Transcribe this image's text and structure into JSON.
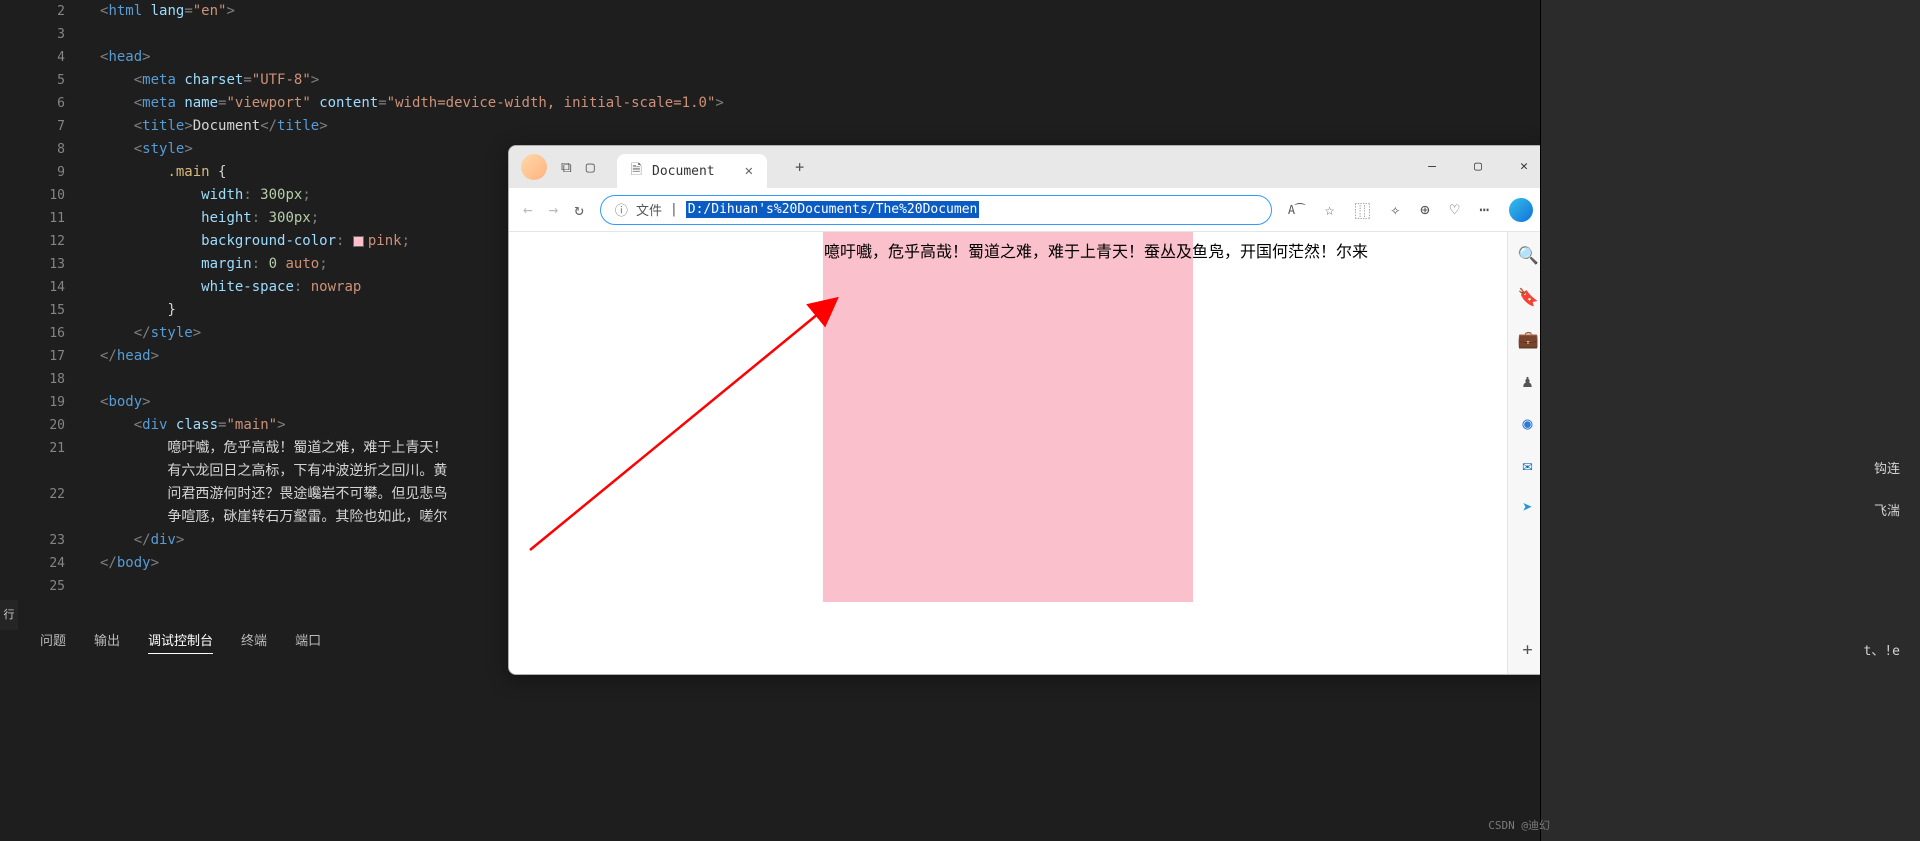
{
  "editor": {
    "line_start": 2,
    "lines": [
      [
        {
          "t": "p",
          "v": "<"
        },
        {
          "t": "tag",
          "v": "html"
        },
        {
          "t": "p",
          "v": " "
        },
        {
          "t": "attr",
          "v": "lang"
        },
        {
          "t": "p",
          "v": "="
        },
        {
          "t": "str",
          "v": "\"en\""
        },
        {
          "t": "p",
          "v": ">"
        }
      ],
      [],
      [
        {
          "t": "p",
          "v": "<"
        },
        {
          "t": "tag",
          "v": "head"
        },
        {
          "t": "p",
          "v": ">"
        }
      ],
      [
        {
          "t": "p",
          "v": "    <"
        },
        {
          "t": "tag",
          "v": "meta"
        },
        {
          "t": "p",
          "v": " "
        },
        {
          "t": "attr",
          "v": "charset"
        },
        {
          "t": "p",
          "v": "="
        },
        {
          "t": "str",
          "v": "\"UTF-8\""
        },
        {
          "t": "p",
          "v": ">"
        }
      ],
      [
        {
          "t": "p",
          "v": "    <"
        },
        {
          "t": "tag",
          "v": "meta"
        },
        {
          "t": "p",
          "v": " "
        },
        {
          "t": "attr",
          "v": "name"
        },
        {
          "t": "p",
          "v": "="
        },
        {
          "t": "str",
          "v": "\"viewport\""
        },
        {
          "t": "p",
          "v": " "
        },
        {
          "t": "attr",
          "v": "content"
        },
        {
          "t": "p",
          "v": "="
        },
        {
          "t": "str",
          "v": "\"width=device-width, initial-scale=1.0\""
        },
        {
          "t": "p",
          "v": ">"
        }
      ],
      [
        {
          "t": "p",
          "v": "    <"
        },
        {
          "t": "tag",
          "v": "title"
        },
        {
          "t": "p",
          "v": ">"
        },
        {
          "t": "cn",
          "v": "Document"
        },
        {
          "t": "p",
          "v": "</"
        },
        {
          "t": "tag",
          "v": "title"
        },
        {
          "t": "p",
          "v": ">"
        }
      ],
      [
        {
          "t": "p",
          "v": "    <"
        },
        {
          "t": "tag",
          "v": "style"
        },
        {
          "t": "p",
          "v": ">"
        }
      ],
      [
        {
          "t": "p",
          "v": "        "
        },
        {
          "t": "sel",
          "v": ".main"
        },
        {
          "t": "p",
          "v": " "
        },
        {
          "t": "brace",
          "v": "{"
        }
      ],
      [
        {
          "t": "p",
          "v": "            "
        },
        {
          "t": "prop",
          "v": "width"
        },
        {
          "t": "p",
          "v": ": "
        },
        {
          "t": "num",
          "v": "300px"
        },
        {
          "t": "p",
          "v": ";"
        }
      ],
      [
        {
          "t": "p",
          "v": "            "
        },
        {
          "t": "prop",
          "v": "height"
        },
        {
          "t": "p",
          "v": ": "
        },
        {
          "t": "num",
          "v": "300px"
        },
        {
          "t": "p",
          "v": ";"
        }
      ],
      [
        {
          "t": "p",
          "v": "            "
        },
        {
          "t": "prop",
          "v": "background-color"
        },
        {
          "t": "p",
          "v": ": "
        },
        {
          "t": "swatch",
          "v": ""
        },
        {
          "t": "kw",
          "v": "pink"
        },
        {
          "t": "p",
          "v": ";"
        }
      ],
      [
        {
          "t": "p",
          "v": "            "
        },
        {
          "t": "prop",
          "v": "margin"
        },
        {
          "t": "p",
          "v": ": "
        },
        {
          "t": "num",
          "v": "0"
        },
        {
          "t": "p",
          "v": " "
        },
        {
          "t": "kw",
          "v": "auto"
        },
        {
          "t": "p",
          "v": ";"
        }
      ],
      [
        {
          "t": "p",
          "v": "            "
        },
        {
          "t": "prop",
          "v": "white-space"
        },
        {
          "t": "p",
          "v": ": "
        },
        {
          "t": "kw",
          "v": "nowrap"
        }
      ],
      [
        {
          "t": "p",
          "v": "        "
        },
        {
          "t": "brace",
          "v": "}"
        }
      ],
      [
        {
          "t": "p",
          "v": "    </"
        },
        {
          "t": "tag",
          "v": "style"
        },
        {
          "t": "p",
          "v": ">"
        }
      ],
      [
        {
          "t": "p",
          "v": "</"
        },
        {
          "t": "tag",
          "v": "head"
        },
        {
          "t": "p",
          "v": ">"
        }
      ],
      [],
      [
        {
          "t": "p",
          "v": "<"
        },
        {
          "t": "tag",
          "v": "body"
        },
        {
          "t": "p",
          "v": ">"
        }
      ],
      [
        {
          "t": "p",
          "v": "    <"
        },
        {
          "t": "tag",
          "v": "div"
        },
        {
          "t": "p",
          "v": " "
        },
        {
          "t": "attr",
          "v": "class"
        },
        {
          "t": "p",
          "v": "="
        },
        {
          "t": "str",
          "v": "\"main\""
        },
        {
          "t": "p",
          "v": ">"
        }
      ],
      [
        {
          "t": "cn",
          "v": "        噫吁嚱，危乎高哉！蜀道之难，难于上青天！"
        }
      ],
      [
        {
          "t": "cn",
          "v": "        有六龙回日之高标，下有冲波逆折之回川。黄"
        }
      ],
      [
        {
          "t": "cn",
          "v": "        问君西游何时还？畏途巉岩不可攀。但见悲鸟"
        }
      ],
      [
        {
          "t": "cn",
          "v": "        争喧豗，砯崖转石万壑雷。其险也如此，嗟尔"
        }
      ],
      [
        {
          "t": "p",
          "v": "    </"
        },
        {
          "t": "tag",
          "v": "div"
        },
        {
          "t": "p",
          "v": ">"
        }
      ],
      [
        {
          "t": "p",
          "v": "</"
        },
        {
          "t": "tag",
          "v": "body"
        },
        {
          "t": "p",
          "v": ">"
        }
      ],
      []
    ],
    "line_numbers": [
      "2",
      "3",
      "4",
      "5",
      "6",
      "7",
      "8",
      "9",
      "10",
      "11",
      "12",
      "13",
      "14",
      "15",
      "16",
      "17",
      "18",
      "19",
      "20",
      "21",
      "",
      "22",
      "",
      "23",
      "24",
      "25"
    ]
  },
  "panel": {
    "tabs": [
      "问题",
      "输出",
      "调试控制台",
      "终端",
      "端口"
    ],
    "active": 2
  },
  "browser": {
    "tab_title": "Document",
    "url_prefix": "文件",
    "url_selected": "D:/Dihuan's%20Documents/The%20Documen",
    "rendered_text": "噫吁嚱，危乎高哉！蜀道之难，难于上青天！蚕丛及鱼凫，开国何茫然！尔来",
    "new_tab_plus": "+"
  },
  "rightbar": {
    "l1": "钩连",
    "l2": "飞湍",
    "l3": "t、!e"
  },
  "watermark": "CSDN @迪幻",
  "leftstub": "行"
}
